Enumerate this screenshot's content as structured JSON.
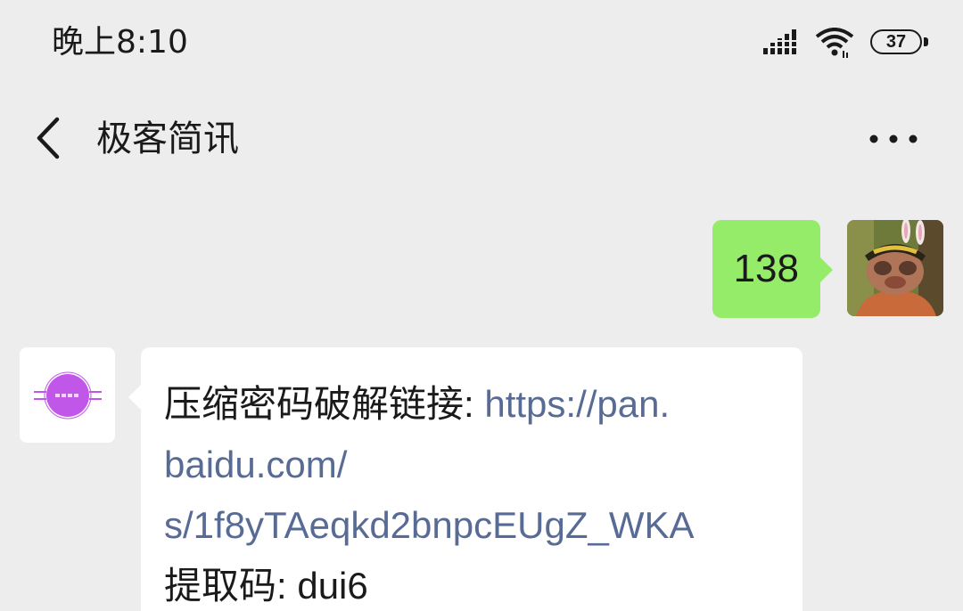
{
  "status_bar": {
    "time": "晚上8:10",
    "battery": "37",
    "signal_icon": "signal-icon",
    "wifi_icon": "wifi-icon"
  },
  "nav": {
    "title": "极客简讯",
    "back_icon": "back-chevron-icon",
    "more_icon": "more-dots-icon"
  },
  "messages": {
    "outgoing": {
      "text": "138",
      "bubble_color": "#95ec69"
    },
    "incoming": {
      "label_prefix": "压缩密码破解链接: ",
      "link_line1": "https://pan.",
      "link_line2": "baidu.com/",
      "link_line3": "s/1f8yTAeqkd2bnpcEUgZ_WKA",
      "code_line": "提取码: dui6",
      "link_color": "#576b95"
    }
  },
  "colors": {
    "background": "#ededed",
    "accent_purple": "#c157e8"
  }
}
